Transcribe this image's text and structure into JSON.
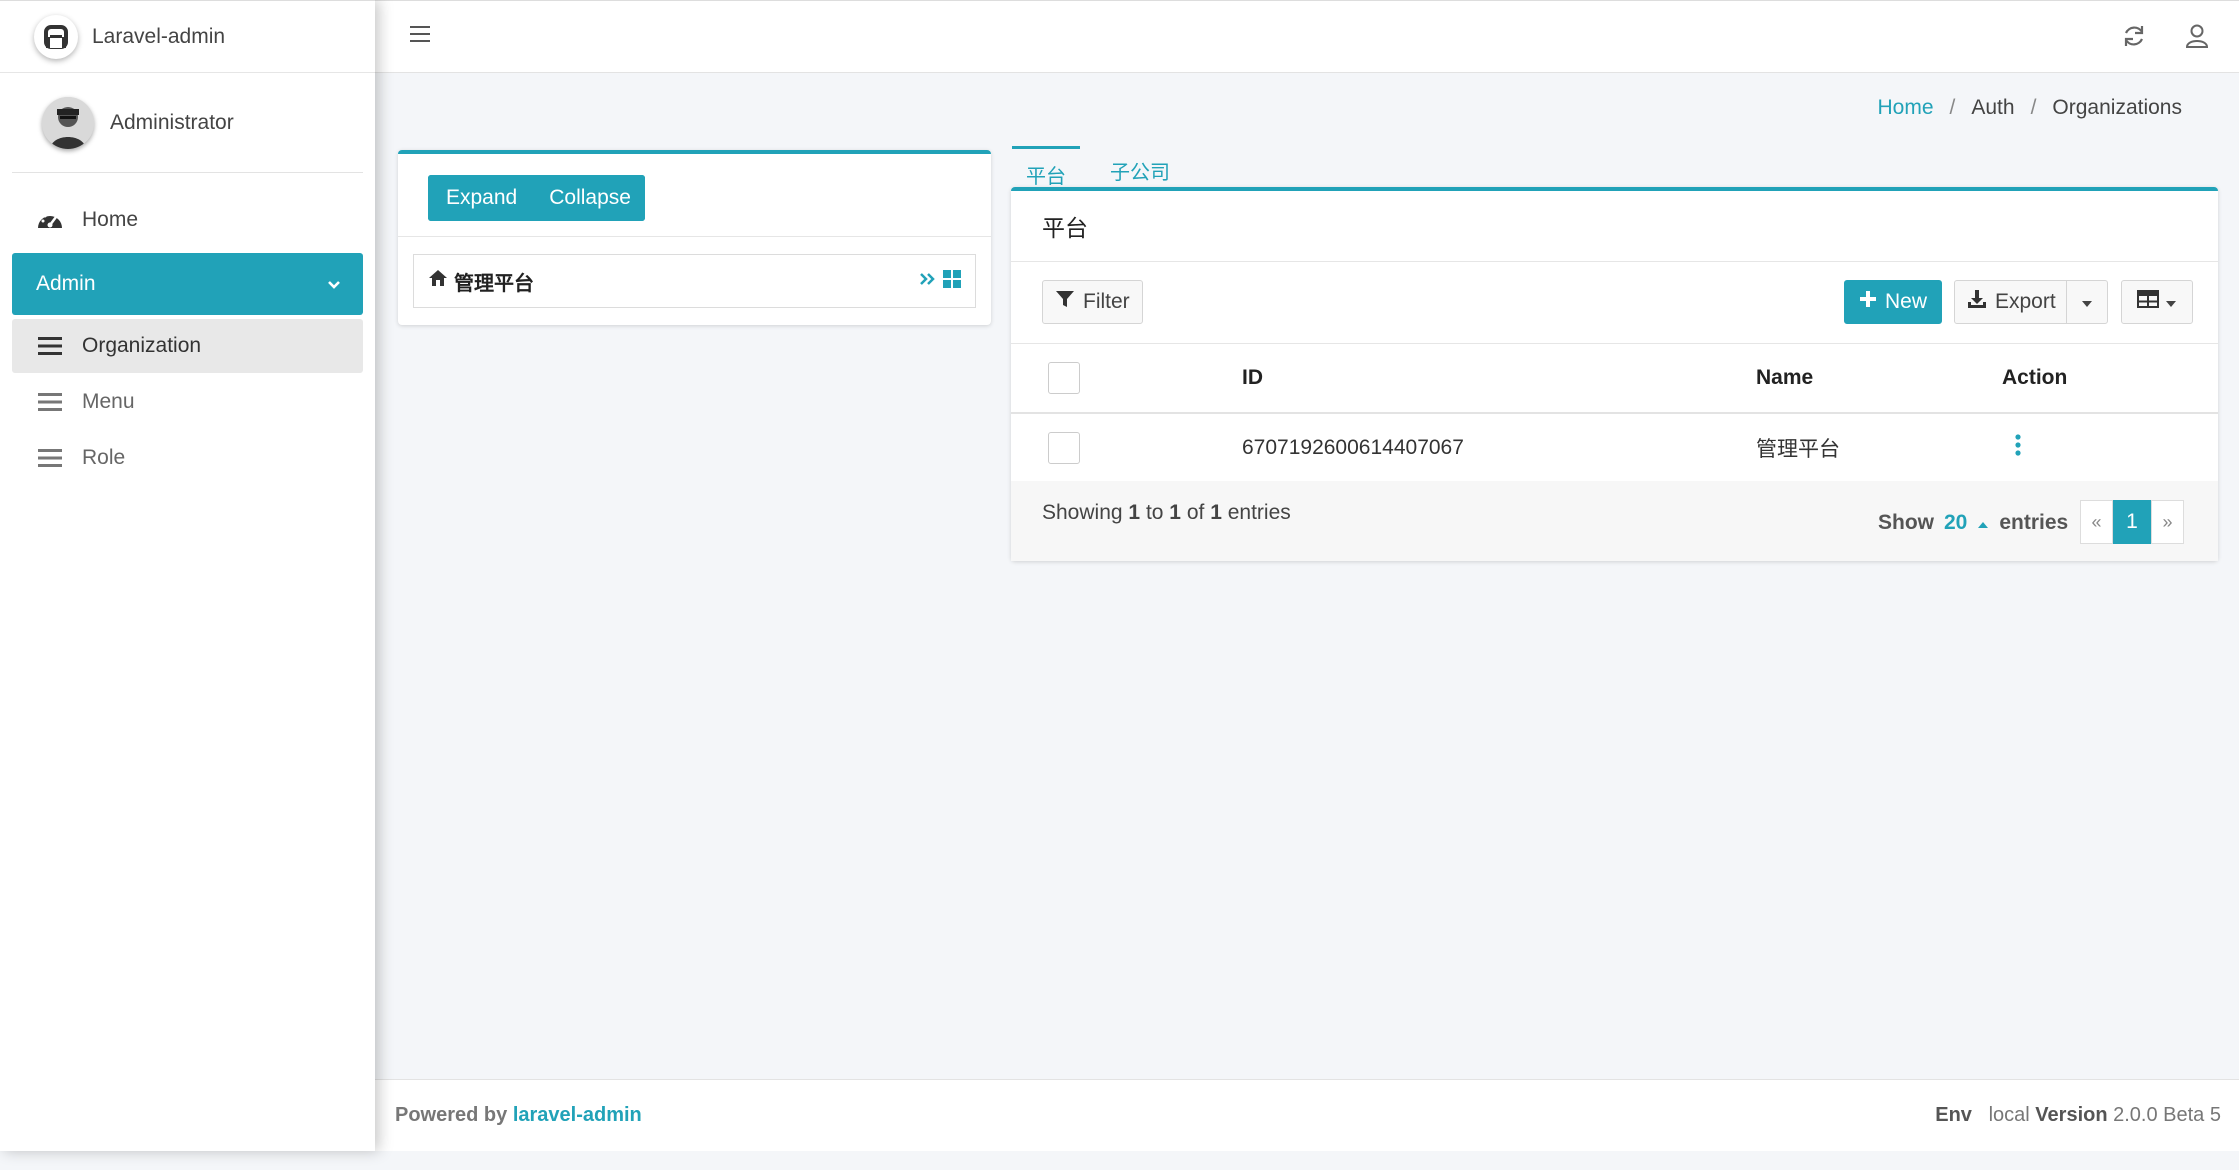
{
  "brand": {
    "name": "Laravel-admin"
  },
  "user": {
    "name": "Administrator"
  },
  "sidebar": {
    "home": "Home",
    "group": "Admin",
    "items": [
      {
        "label": "Organization"
      },
      {
        "label": "Menu"
      },
      {
        "label": "Role"
      }
    ]
  },
  "breadcrumb": {
    "home": "Home",
    "auth": "Auth",
    "current": "Organizations",
    "sep": "/"
  },
  "tree": {
    "expand_label": "Expand",
    "collapse_label": "Collapse",
    "node_label": "管理平台"
  },
  "tabs": [
    {
      "label": "平台"
    },
    {
      "label": "子公司"
    }
  ],
  "panel": {
    "title": "平台",
    "filter_label": "Filter",
    "new_label": "New",
    "export_label": "Export",
    "columns": {
      "id": "ID",
      "name": "Name",
      "action": "Action"
    },
    "rows": [
      {
        "id": "6707192600614407067",
        "name": "管理平台"
      }
    ],
    "showing": {
      "prefix": "Showing",
      "from": "1",
      "to_word": "to",
      "to": "1",
      "of_word": "of",
      "total": "1",
      "suffix": "entries"
    },
    "per_page": {
      "show_word": "Show",
      "value": "20",
      "entries_word": "entries"
    },
    "pager": {
      "prev": "«",
      "current": "1",
      "next": "»"
    }
  },
  "footer": {
    "powered_by": "Powered by",
    "powered_link": "laravel-admin",
    "env_label": "Env",
    "env_value": "local",
    "version_label": "Version",
    "version_value": "2.0.0 Beta 5"
  },
  "colors": {
    "accent": "#21a2b8"
  },
  "icons": [
    "logo-icon",
    "avatar",
    "dashboard-icon",
    "chevron-down-icon",
    "bars-icon",
    "hamburger-icon",
    "refresh-icon",
    "user-icon",
    "home-icon",
    "double-chevron-right-icon",
    "grid-icon",
    "filter-icon",
    "plus-icon",
    "download-icon",
    "caret-down-icon",
    "table-icon",
    "vertical-ellipsis-icon",
    "caret-up-icon"
  ]
}
